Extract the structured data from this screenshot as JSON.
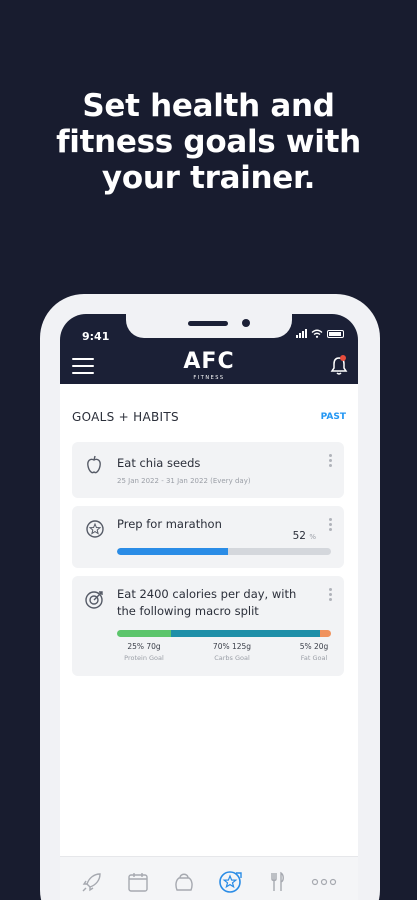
{
  "headline": {
    "line1": "Set health and",
    "line2": "fitness goals with",
    "line3": "your trainer."
  },
  "status_bar": {
    "time": "9:41"
  },
  "app_header": {
    "logo": "AFC",
    "logo_sub": "FITNESS",
    "menu_icon": "hamburger-menu-icon",
    "bell_icon": "bell-icon"
  },
  "section": {
    "title": "GOALS + HABITS",
    "past_label": "PAST"
  },
  "goals": [
    {
      "icon": "apple-icon",
      "title": "Eat chia seeds",
      "subtitle": "25 Jan 2022 - 31 Jan 2022 (Every day)"
    },
    {
      "icon": "medal-icon",
      "title": "Prep for marathon",
      "progress_percent": 52,
      "progress_text": "52",
      "percent_sign": "%"
    },
    {
      "icon": "target-icon",
      "title_line1": "Eat 2400 calories per day, with",
      "title_line2": "the following macro split",
      "macros": [
        {
          "value": "25% 70g",
          "name": "Protein Goal",
          "percent": 25,
          "color": "#5cc56b"
        },
        {
          "value": "70% 125g",
          "name": "Carbs Goal",
          "percent": 70,
          "color": "#1f8fa8"
        },
        {
          "value": "5% 20g",
          "name": "Fat Goal",
          "percent": 5,
          "color": "#f0925d"
        }
      ]
    }
  ],
  "tabbar": {
    "items": [
      {
        "icon": "rocket-icon",
        "active": false
      },
      {
        "icon": "calendar-icon",
        "active": false
      },
      {
        "icon": "kettlebell-icon",
        "active": false
      },
      {
        "icon": "goals-medal-icon",
        "active": true
      },
      {
        "icon": "fork-knife-icon",
        "active": false
      },
      {
        "icon": "more-dots-icon",
        "active": false
      }
    ]
  },
  "colors": {
    "background": "#181c2f",
    "app_header": "#1b2036",
    "accent_blue": "#2a8ce6",
    "notification_dot": "#e74c3c"
  }
}
